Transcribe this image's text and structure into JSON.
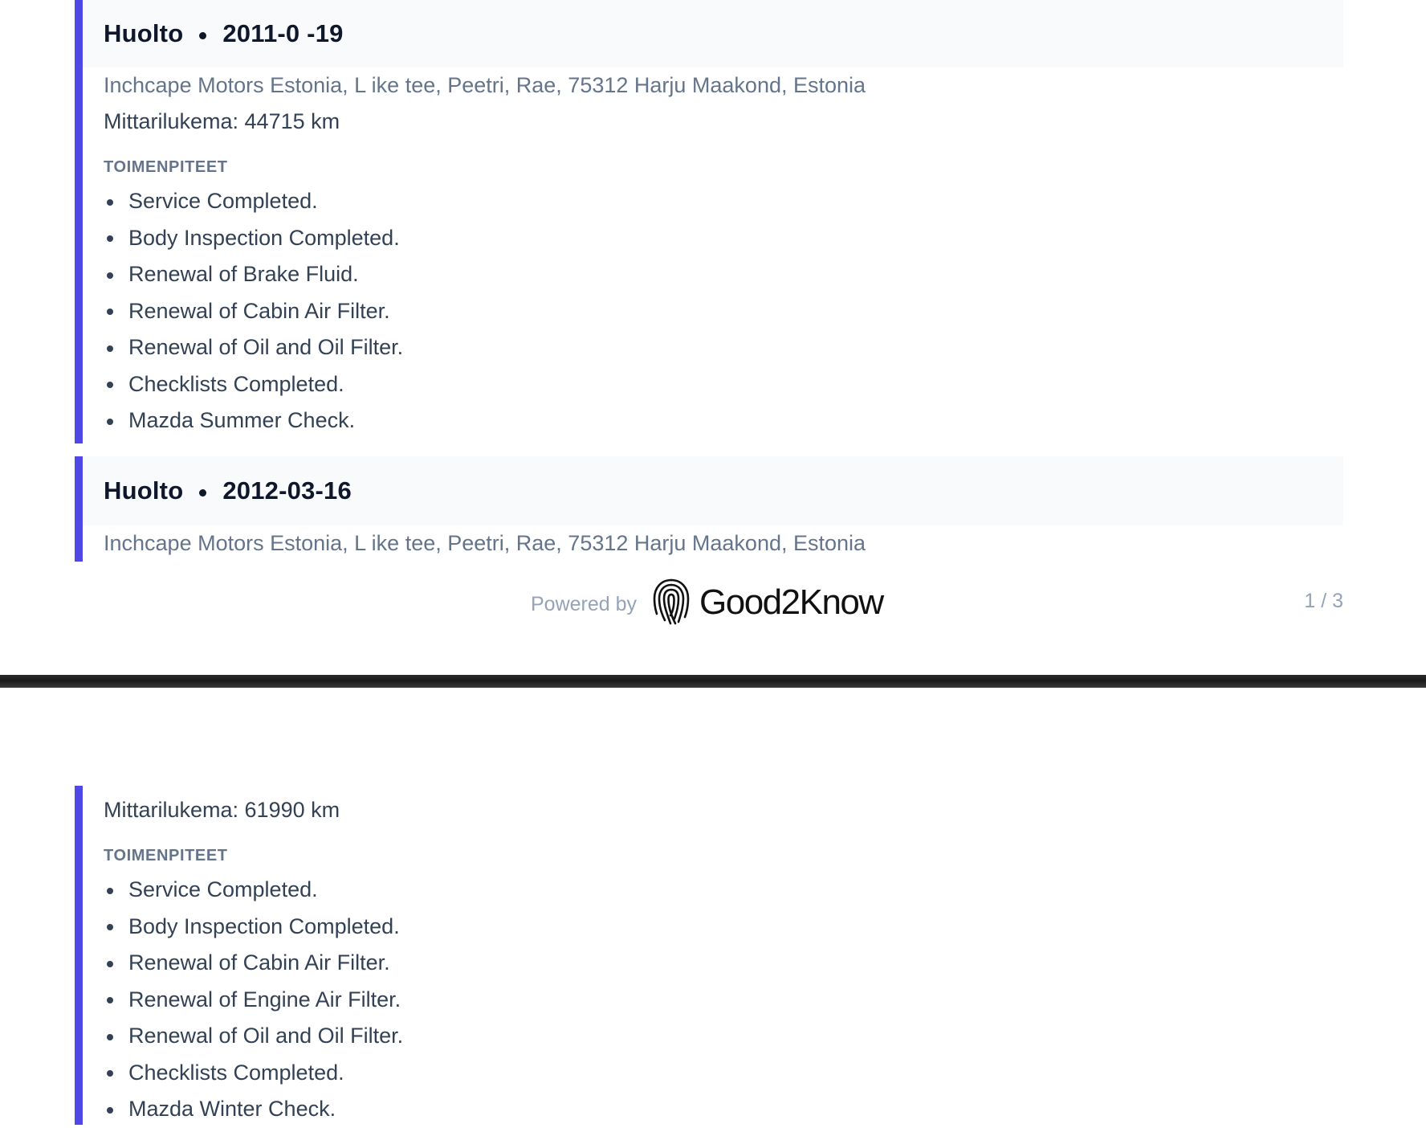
{
  "page1": {
    "records": [
      {
        "type": "Huolto",
        "date": "2011-0  -19",
        "address": "Inchcape Motors Estonia, L  ike tee, Peetri, Rae, 75312 Harju Maakond, Estonia",
        "mileage": "Mittarilukema: 44715 km",
        "actions_label": "TOIMENPITEET",
        "actions": [
          "Service Completed.",
          "Body Inspection Completed.",
          "Renewal of Brake Fluid.",
          "Renewal of Cabin Air Filter.",
          "Renewal of Oil and Oil Filter.",
          "Checklists Completed.",
          "Mazda Summer Check."
        ]
      },
      {
        "type": "Huolto",
        "date": "2012-03-16",
        "address": "Inchcape Motors Estonia, L  ike tee, Peetri, Rae, 75312 Harju Maakond, Estonia"
      }
    ],
    "footer": {
      "powered_by": "Powered by",
      "brand": "Good2Know",
      "page_number": "1 / 3"
    }
  },
  "page2": {
    "continued_record": {
      "mileage": "Mittarilukema: 61990 km",
      "actions_label": "TOIMENPITEET",
      "actions": [
        "Service Completed.",
        "Body Inspection Completed.",
        "Renewal of Cabin Air Filter.",
        "Renewal of Engine Air Filter.",
        "Renewal of Oil and Oil Filter.",
        "Checklists Completed.",
        "Mazda Winter Check."
      ]
    }
  },
  "colors": {
    "accent": "#5048e5",
    "header_bg": "#f8fafc",
    "muted_text": "#64748b",
    "body_text": "#334155",
    "title_text": "#0f172a"
  },
  "icons": {
    "logo": "fingerprint-icon"
  }
}
